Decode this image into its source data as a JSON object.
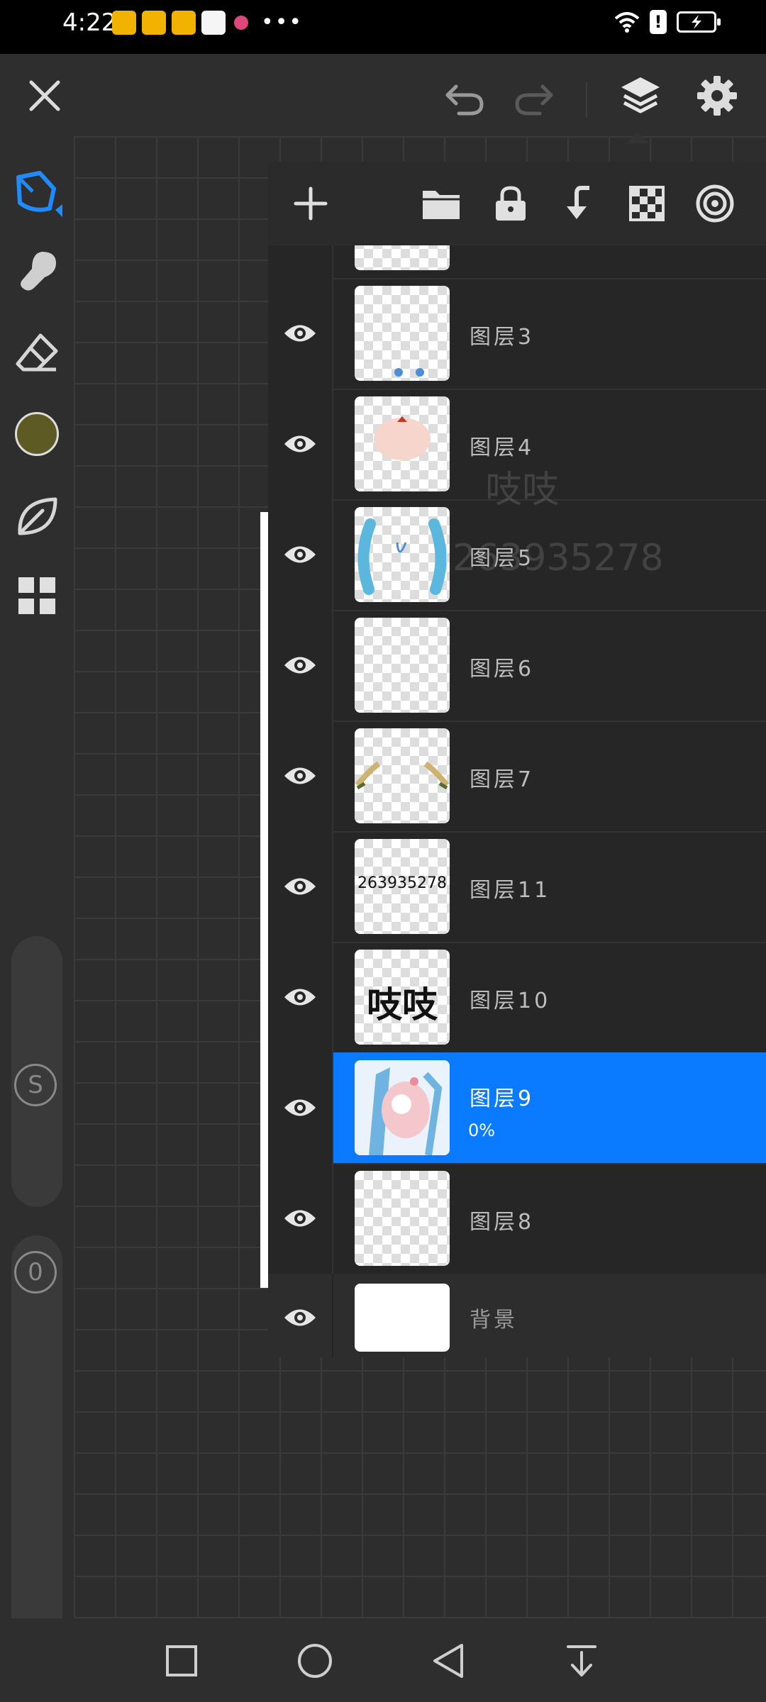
{
  "status_bar": {
    "time": "4:22",
    "dots": "•••",
    "warning": "!"
  },
  "toolbar": {
    "close_icon": "close-icon",
    "undo_icon": "undo-icon",
    "redo_icon": "redo-icon",
    "layers_icon": "layers-icon",
    "settings_icon": "gear-icon"
  },
  "tools": {
    "brush": "pen-icon",
    "smudge": "smudge-icon",
    "eraser": "eraser-icon",
    "color": "#5e5a23",
    "leaf": "leaf-icon",
    "grid": "grid-icon",
    "size_badge": "S",
    "opacity_badge": "0"
  },
  "layer_panel": {
    "toolbar_icons": [
      "add-icon",
      "folder-icon",
      "lock-icon",
      "merge-down-icon",
      "checker-icon",
      "reference-icon"
    ],
    "layers": [
      {
        "name": "图层3",
        "selected": false
      },
      {
        "name": "图层4",
        "selected": false
      },
      {
        "name": "图层5",
        "selected": false
      },
      {
        "name": "图层6",
        "selected": false
      },
      {
        "name": "图层7",
        "selected": false
      },
      {
        "name": "图层11",
        "selected": false,
        "thumb_text": "263935278"
      },
      {
        "name": "图层10",
        "selected": false,
        "thumb_text": "吱吱"
      },
      {
        "name": "图层9",
        "selected": true,
        "opacity": "0%"
      },
      {
        "name": "图层8",
        "selected": false
      }
    ],
    "background_layer": {
      "name": "背景"
    }
  },
  "canvas_watermark": {
    "text1": "吱吱",
    "text2": "263935278"
  },
  "colors": {
    "accent": "#0a7bff",
    "art_blue": "#5bb7dd"
  }
}
